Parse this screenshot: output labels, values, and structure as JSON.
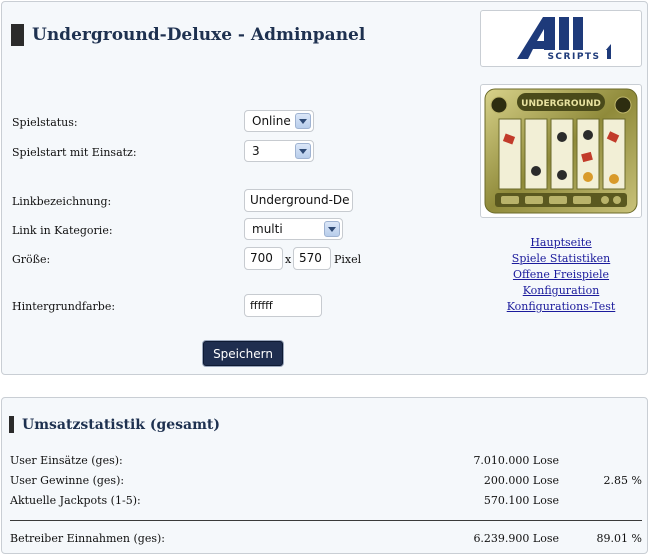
{
  "header": {
    "title": "Underground-Deluxe - Adminpanel"
  },
  "brand": {
    "logo_letter": "ALL",
    "logo_word": "SCRIPTS",
    "logo_color": "#1e3a7a"
  },
  "game_preview": {
    "title": "UNDERGROUND"
  },
  "form": {
    "status_label": "Spielstatus:",
    "status_value": "Online",
    "start_label": "Spielstart mit Einsatz:",
    "start_value": "3",
    "linkname_label": "Linkbezeichnung:",
    "linkname_value": "Underground-De",
    "category_label": "Link in Kategorie:",
    "category_value": "multi",
    "size_label": "Größe:",
    "width_value": "700",
    "size_sep": "x",
    "height_value": "570",
    "size_unit": "Pixel",
    "bg_label": "Hintergrundfarbe:",
    "bg_value": "ffffff",
    "save_label": "Speichern"
  },
  "nav": {
    "items": [
      "Hauptseite",
      "Spiele Statistiken",
      "Offene Freispiele",
      "Konfiguration",
      "Konfigurations-Test"
    ]
  },
  "stats": {
    "title": "Umsatzstatistik (gesamt)",
    "rows": [
      {
        "label": "User Einsätze (ges):",
        "amount": "7.010.000 Lose",
        "percent": ""
      },
      {
        "label": "User Gewinne (ges):",
        "amount": "200.000 Lose",
        "percent": "2.85 %"
      },
      {
        "label": "Aktuelle Jackpots (1-5):",
        "amount": "570.100 Lose",
        "percent": ""
      }
    ],
    "total": {
      "label": "Betreiber Einnahmen (ges):",
      "amount": "6.239.900 Lose",
      "percent": "89.01 %"
    }
  }
}
